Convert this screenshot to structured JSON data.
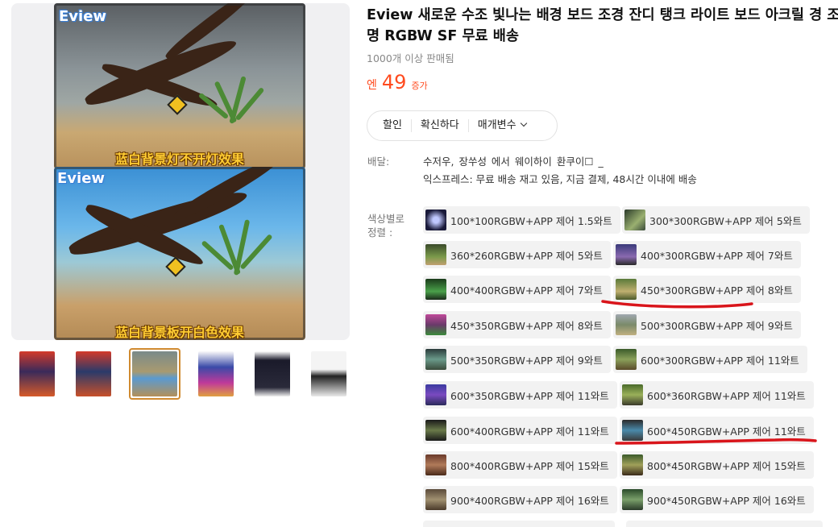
{
  "gallery": {
    "brand_top": "Eview",
    "brand_bottom": "Eview",
    "caption_top": "蓝白背景灯不开灯效果",
    "caption_bottom": "蓝白背景板开白色效果"
  },
  "product": {
    "title": "Eview 새로운 수조 빛나는 배경 보드 조경 잔디 탱크 라이트 보드 아크릴 경 조명 RGBW SF 무료 배송",
    "sold": "1000개 이상 판매됨",
    "price_currency": "엔",
    "price_value": "49",
    "price_suffix": "증가"
  },
  "tabs": [
    {
      "label": "할인"
    },
    {
      "label": "확신하다"
    },
    {
      "label": "매개변수"
    }
  ],
  "shipping": {
    "label": "배달:",
    "line1": "수저우, 장쑤성   에서  웨이하이     환쿠이☐   _",
    "line2": "익스프레스: 무료 배송  재고 있음, 지금 결제, 48시간 이내에 배송"
  },
  "color_label": "색상별로 정렬 :",
  "options": [
    {
      "label": "100*100RGBW+APP 제어 1.5와트"
    },
    {
      "label": "300*300RGBW+APP 제어 5와트"
    },
    {
      "label": "360*260RGBW+APP 제어 5와트"
    },
    {
      "label": "400*300RGBW+APP 제어 7와트"
    },
    {
      "label": "400*400RGBW+APP 제어 7와트"
    },
    {
      "label": "450*300RGBW+APP 제어 8와트"
    },
    {
      "label": "450*350RGBW+APP 제어 8와트"
    },
    {
      "label": "500*300RGBW+APP 제어 9와트"
    },
    {
      "label": "500*350RGBW+APP 제어 9와트"
    },
    {
      "label": "600*300RGBW+APP 제어 11와트"
    },
    {
      "label": "600*350RGBW+APP 제어 11와트"
    },
    {
      "label": "600*360RGBW+APP 제어 11와트"
    },
    {
      "label": "600*400RGBW+APP 제어 11와트"
    },
    {
      "label": "600*450RGBW+APP 제어 11와트"
    },
    {
      "label": "800*400RGBW+APP 제어 15와트"
    },
    {
      "label": "800*450RGBW+APP 제어 15와트"
    },
    {
      "label": "900*400RGBW+APP 제어 16와트"
    },
    {
      "label": "900*450RGBW+APP 제어 16와트"
    }
  ],
  "colors": {
    "price": "#ff4b1f",
    "annotation": "#d9151b",
    "active_thumb_border": "#d08a30"
  }
}
